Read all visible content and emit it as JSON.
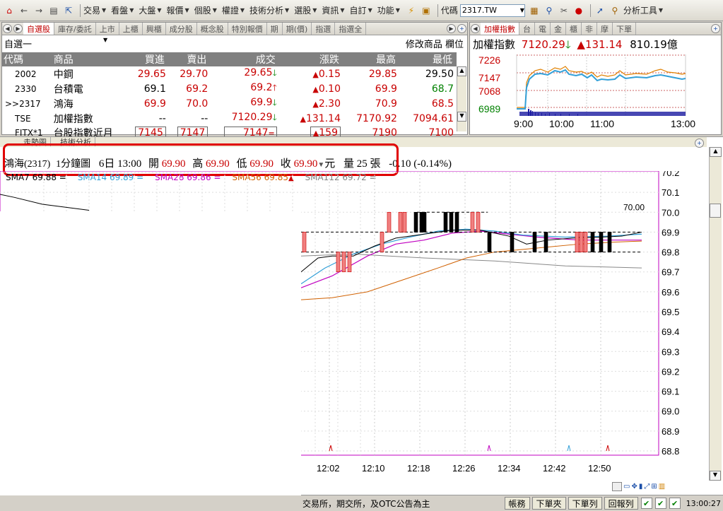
{
  "menubar": {
    "menus": [
      "交易",
      "看盤",
      "大盤",
      "報價",
      "個股",
      "權證",
      "技術分析",
      "選股",
      "資訊",
      "自訂",
      "功能"
    ],
    "code_label": "代碼",
    "code_value": "2317.TW",
    "analysis_tools": "分析工具"
  },
  "watchlist": {
    "tabs": [
      "自選股",
      "庫存/委託",
      "上市",
      "上櫃",
      "興櫃",
      "成分股",
      "概念股",
      "特別報價",
      "期",
      "期(價)",
      "指選",
      "指選全"
    ],
    "group_name": "自選一",
    "modify_label": "修改商品",
    "column_label": "欄位",
    "headers": [
      "代碼",
      "商品",
      "買進",
      "賣出",
      "成交",
      "漲跌",
      "最高",
      "最低"
    ],
    "rows": [
      {
        "code": "2002",
        "name": "中鋼",
        "bid": "29.65",
        "ask": "29.70",
        "last": "29.65",
        "last_dir": "down",
        "change": "0.15",
        "high": "29.85",
        "low": "29.50",
        "low_color": "#000000"
      },
      {
        "code": "2330",
        "name": "台積電",
        "bid": "69.1",
        "ask": "69.2",
        "last": "69.2",
        "last_dir": "up",
        "change": "0.10",
        "high": "69.9",
        "low": "68.7",
        "low_color": "#008000"
      },
      {
        "code": ">>2317",
        "name": "鴻海",
        "bid": "69.9",
        "ask": "70.0",
        "last": "69.9",
        "last_dir": "down",
        "change": "2.30",
        "high": "70.9",
        "low": "68.5",
        "low_color": "#c80000"
      },
      {
        "code": "TSE",
        "name": "加權指數",
        "bid": "--",
        "ask": "--",
        "last": "7120.29",
        "last_dir": "down",
        "change": "131.14",
        "high": "7170.92",
        "low": "7094.61",
        "low_color": "#c80000"
      },
      {
        "code": "FITX*1",
        "name": "台股指數近月",
        "bid": "7145",
        "ask": "7147",
        "last": "7147",
        "last_dir": "flat",
        "change": "159",
        "high": "7190",
        "low": "7100",
        "low_color": "#c80000"
      }
    ]
  },
  "index_panel": {
    "tabs": [
      "加權指數",
      "台",
      "電",
      "金",
      "櫃",
      "非",
      "摩",
      "下單"
    ],
    "name": "加權指數",
    "value": "7120.29",
    "change": "131.14",
    "volume": "810.19億",
    "y_ticks": [
      "7226",
      "7147",
      "7068",
      "6989"
    ],
    "x_ticks": [
      "9:00",
      "10:00",
      "11:00",
      "13:00"
    ]
  },
  "chart_tabs": [
    "走勢圖",
    "技術分析"
  ],
  "info_bar": {
    "stock": "鴻海(2317)",
    "period": "1分鐘圖",
    "date": "6日 13:00",
    "open_label": "開",
    "open": "69.90",
    "high_label": "高",
    "high": "69.90",
    "low_label": "低",
    "low": "69.90",
    "close_label": "收",
    "close": "69.90",
    "unit": "元",
    "vol_label": "量",
    "vol": "25",
    "vol_unit": "張",
    "change": "-0.10 (-0.14%)"
  },
  "ma_bar": [
    "SMA7 69.88 =",
    "SMA14 69.89 =",
    "SMA28 69.86 =",
    "SMA56 69.85",
    "SMA112 69.72 ="
  ],
  "chart_data": {
    "type": "candlestick",
    "y_ticks": [
      "70.2",
      "70.1",
      "70.0",
      "69.9",
      "69.8",
      "69.7",
      "69.6",
      "69.5",
      "69.4",
      "69.3",
      "69.2",
      "69.1",
      "69.0",
      "68.9",
      "68.8"
    ],
    "x_ticks": [
      "12:02",
      "12:10",
      "12:18",
      "12:26",
      "12:34",
      "12:42",
      "12:50"
    ],
    "ylim": [
      68.8,
      70.2
    ],
    "annotation": "70.00"
  },
  "status": {
    "text": "交易所，期交所，及OTC公告為主",
    "buttons": [
      "帳務",
      "下單夾",
      "下單列",
      "回報列"
    ],
    "time": "13:00:27"
  }
}
